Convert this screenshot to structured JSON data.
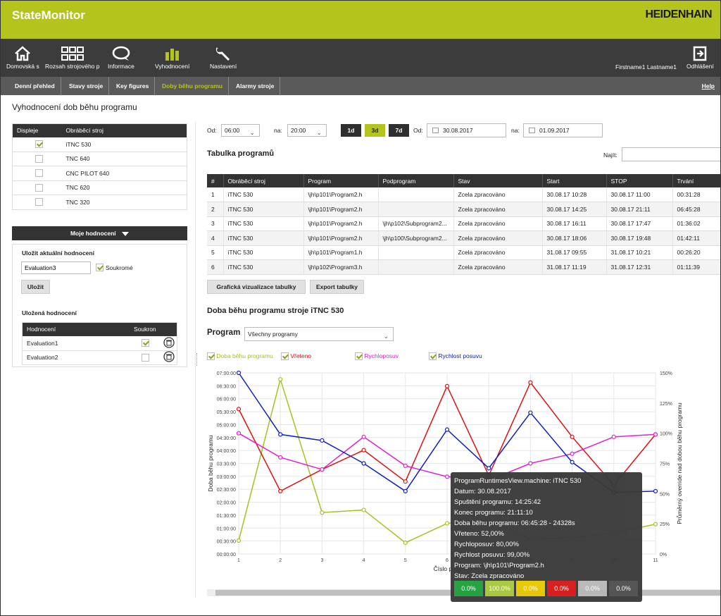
{
  "header": {
    "app_title": "StateMonitor",
    "brand": "HEIDENHAIN"
  },
  "nav": {
    "items": [
      {
        "label": "Domovská s",
        "icon": "home-icon"
      },
      {
        "label": "Rozsah strojového p",
        "icon": "grid-icon"
      },
      {
        "label": "Informace",
        "icon": "chat-icon"
      },
      {
        "label": "Vyhodnocení",
        "icon": "bar-chart-icon"
      },
      {
        "label": "Nastavení",
        "icon": "wrench-icon"
      }
    ],
    "user": "Firstname1 Lastname1",
    "logout": "Odhlášení"
  },
  "subnav": {
    "tabs": [
      "Denní přehled",
      "Stavy stroje",
      "Key figures",
      "Doby běhu programu",
      "Alarmy stroje"
    ],
    "active": "Doby běhu programu",
    "help": "Help"
  },
  "page_title": "Vyhodnocení dob běhu programu",
  "machines": {
    "headers": [
      "Displeje",
      "Obráběcí stroj"
    ],
    "rows": [
      {
        "checked": true,
        "name": "iTNC 530"
      },
      {
        "checked": false,
        "name": "TNC 640"
      },
      {
        "checked": false,
        "name": "CNC PILOT 640"
      },
      {
        "checked": false,
        "name": "TNC 620"
      },
      {
        "checked": false,
        "name": "TNC 320"
      }
    ]
  },
  "my_eval": {
    "toggle": "Moje hodnocení",
    "save_title": "Uložit aktuální hodnocení",
    "name_value": "Evaluation3",
    "private_label": "Soukromé",
    "save_button": "Uložit",
    "saved_title": "Uložená hodnocení",
    "saved_headers": [
      "Hodnocení",
      "Soukron"
    ],
    "saved_rows": [
      {
        "name": "Evaluation1",
        "private": true
      },
      {
        "name": "Evaluation2",
        "private": false
      }
    ]
  },
  "filters": {
    "from_label": "Od:",
    "from_time": "06:00",
    "to_label": "na:",
    "to_time": "20:00",
    "ranges": [
      "1d",
      "3d",
      "7d"
    ],
    "active_range": "3d",
    "date_from_label": "Od:",
    "date_from": "30.08.2017",
    "date_to_label": "na:",
    "date_to": "01.09.2017"
  },
  "program_table": {
    "title": "Tabulka programů",
    "search_label": "Najít:",
    "headers": [
      "#",
      "Obráběcí stroj",
      "Program",
      "Podprogram",
      "Stav",
      "Start",
      "STOP",
      "Trvání"
    ],
    "rows": [
      [
        "1",
        "iTNC 530",
        "\\jh\\p101\\Program2.h",
        "",
        "Zcela zpracováno",
        "30.08.17 10:28",
        "30.08.17 11:00",
        "00:31:28"
      ],
      [
        "2",
        "iTNC 530",
        "\\jh\\p101\\Program2.h",
        "",
        "Zcela zpracováno",
        "30.08.17 14:25",
        "30.08.17 21:11",
        "06:45:28"
      ],
      [
        "3",
        "iTNC 530",
        "\\jh\\p101\\Program2.h",
        "\\jh\\p102\\Subprogram2...",
        "Zcela zpracováno",
        "30.08.17 16:11",
        "30.08.17 17:47",
        "01:36:02"
      ],
      [
        "4",
        "iTNC 530",
        "\\jh\\p101\\Program2.h",
        "\\jh\\p100\\Subprogram2...",
        "Zcela zpracováno",
        "30.08.17 18:06",
        "30.08.17 19:48",
        "01:42:11"
      ],
      [
        "5",
        "iTNC 530",
        "\\jh\\p101\\Program1.h",
        "",
        "Zcela zpracováno",
        "31.08.17 09:55",
        "31.08.17 10:21",
        "00:26:20"
      ],
      [
        "6",
        "iTNC 530",
        "\\jh\\p102\\Program3.h",
        "",
        "Zcela zpracováno",
        "31.08.17 11:19",
        "31.08.17 12:31",
        "01:11:39"
      ]
    ],
    "buttons": [
      "Grafická vizualizace tabulky",
      "Export tabulky"
    ]
  },
  "chart_section": {
    "title": "Doba běhu programu stroje iTNC 530",
    "program_label": "Program",
    "program_select": "Všechny programy"
  },
  "chart_data": {
    "type": "line",
    "x": [
      1,
      2,
      3,
      4,
      5,
      6,
      7,
      8,
      9,
      10,
      11
    ],
    "xlabel": "Číslo prog",
    "ylabel": "Doba běhu programu",
    "y2label": "Průměrný override nad dobou běhu programu",
    "y_ticks": [
      "00:00:00",
      "00:30:00",
      "01:00:00",
      "01:30:00",
      "02:00:00",
      "02:30:00",
      "03:00:00",
      "03:30:00",
      "04:00:00",
      "04:30:00",
      "05:00:00",
      "05:30:00",
      "06:00:00",
      "06:30:00",
      "07:00:00"
    ],
    "y2_ticks": [
      "0%",
      "25%",
      "50%",
      "75%",
      "100%",
      "125%",
      "150%"
    ],
    "ylim_minutes": [
      0,
      420
    ],
    "y2lim": [
      0,
      150
    ],
    "grid": true,
    "series": [
      {
        "name": "Doba běhu programu",
        "color": "#a8c020",
        "axis": "time_minutes",
        "values": [
          31,
          405,
          96,
          102,
          26,
          71,
          79,
          34,
          38,
          49,
          69
        ]
      },
      {
        "name": "Vřeteno",
        "color": "#e01010",
        "axis": "percent",
        "values": [
          120,
          52,
          70,
          86,
          60,
          139,
          65,
          142,
          97,
          57,
          99
        ]
      },
      {
        "name": "Rychloposuv",
        "color": "#e020d0",
        "axis": "percent",
        "values": [
          100,
          80,
          70,
          97,
          73,
          64,
          61,
          75,
          83,
          97,
          99
        ]
      },
      {
        "name": "Rychlost posuvu",
        "color": "#1020c0",
        "axis": "percent",
        "values": [
          150,
          99,
          94,
          75,
          52,
          103,
          71,
          117,
          76,
          51,
          52
        ]
      }
    ]
  },
  "tooltip": {
    "lines": [
      "ProgramRuntimesView.machine: iTNC 530",
      "Datum: 30.08.2017",
      "Spuštění programu: 14:25:42",
      "Konec programu: 21:11:10",
      "Doba běhu programu: 06:45:28 - 24328s",
      "Vřeteno: 52,00%",
      "Rychloposuv: 80,00%",
      "Rychlost posuvu: 99,00%",
      "Program: \\jh\\p101\\Program2.h",
      "Stav: Zcela zpracováno"
    ],
    "chips": [
      {
        "value": "0.0%",
        "color": "#1ea03c"
      },
      {
        "value": "100.0%",
        "color": "#a8c83c"
      },
      {
        "value": "0.0%",
        "color": "#e8c800"
      },
      {
        "value": "0.0%",
        "color": "#d81818"
      },
      {
        "value": "0.0%",
        "color": "#b8b8b8"
      },
      {
        "value": "0.0%",
        "color": "#505050"
      }
    ]
  }
}
